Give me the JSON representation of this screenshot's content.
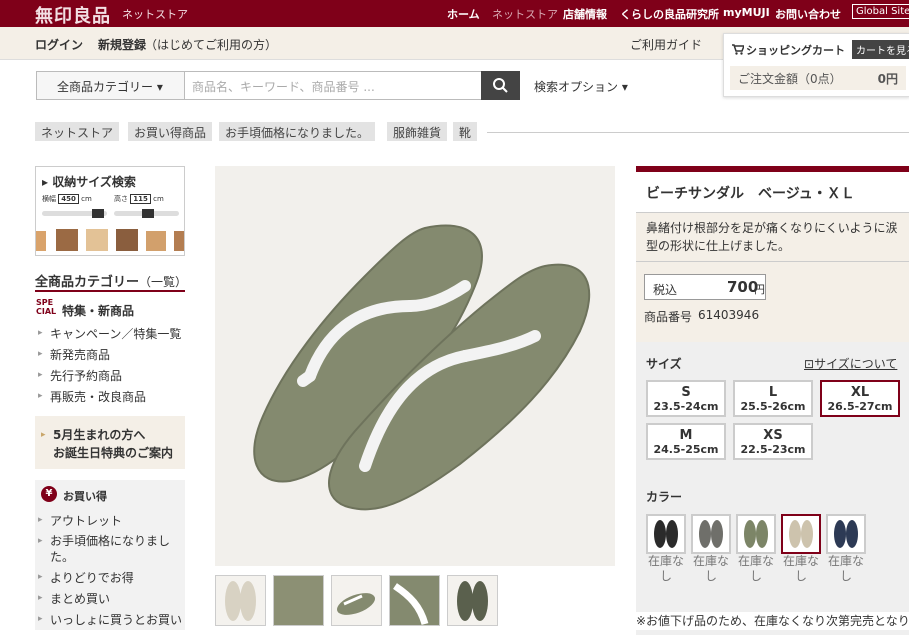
{
  "topbar": {
    "logo": "無印良品",
    "store": "ネットストア",
    "nav": [
      "ホーム",
      "ネットストア",
      "店舗情報",
      "くらしの良品研究所",
      "myMUJI",
      "お問い合わせ"
    ],
    "global": "Global Site"
  },
  "secbar": {
    "login": "ログイン",
    "register": "新規登録",
    "register_note": "（はじめてご利用の方）",
    "guide": "ご利用ガイド"
  },
  "cart": {
    "title": "ショッピングカート",
    "button": "カートを見る",
    "amount_label": "ご注文金額（0点）",
    "amount": "0円"
  },
  "search": {
    "category": "全商品カテゴリー",
    "placeholder": "商品名、キーワード、商品番号 ...",
    "options": "検索オプション"
  },
  "breadcrumb": [
    "ネットストア",
    "お買い得商品",
    "お手頃価格になりました。",
    "服飾雑貨",
    "靴"
  ],
  "size_search": {
    "title": "収納サイズ検索",
    "w_label": "横幅",
    "w_value": "450",
    "h_label": "高さ",
    "h_value": "115",
    "unit": "cm"
  },
  "sidebar": {
    "cat_title": "全商品カテゴリー",
    "cat_suffix": "（一覧）",
    "special_logo": "SPE CIAL",
    "special": "特集・新商品",
    "links": [
      "キャンペーン／特集一覧",
      "新発売商品",
      "先行予約商品",
      "再販売・改良商品"
    ],
    "bday_line1": "5月生まれの方へ",
    "bday_line2": "お誕生日特典のご案内",
    "deals_title": "お買い得",
    "deals": [
      "アウトレット",
      "お手頃価格になりました。",
      "よりどりでお得",
      "まとめ買い",
      "いっしょに買うとお買い"
    ]
  },
  "product": {
    "title": "ビーチサンダル　ベージュ・ＸＬ",
    "desc": "鼻緒付け根部分を足が痛くなりにくいように涙型の形状に仕上げました。",
    "tax_label": "税込",
    "price": "700",
    "yen": "円",
    "code_label": "商品番号",
    "code": "61403946",
    "size_label": "サイズ",
    "size_link": "サイズについて",
    "sizes": [
      {
        "l": "S",
        "r": "23.5-24cm"
      },
      {
        "l": "L",
        "r": "25.5-26cm"
      },
      {
        "l": "XL",
        "r": "26.5-27cm"
      },
      {
        "l": "M",
        "r": "24.5-25cm"
      },
      {
        "l": "XS",
        "r": "22.5-23cm"
      }
    ],
    "color_label": "カラー",
    "stock": "在庫なし",
    "note": "※お値下げ品のため、在庫なくなり次第完売となり",
    "colors": [
      "#2b2b2b",
      "#6f6f6a",
      "#7c8567",
      "#cdc3ad",
      "#2d3a55"
    ]
  }
}
